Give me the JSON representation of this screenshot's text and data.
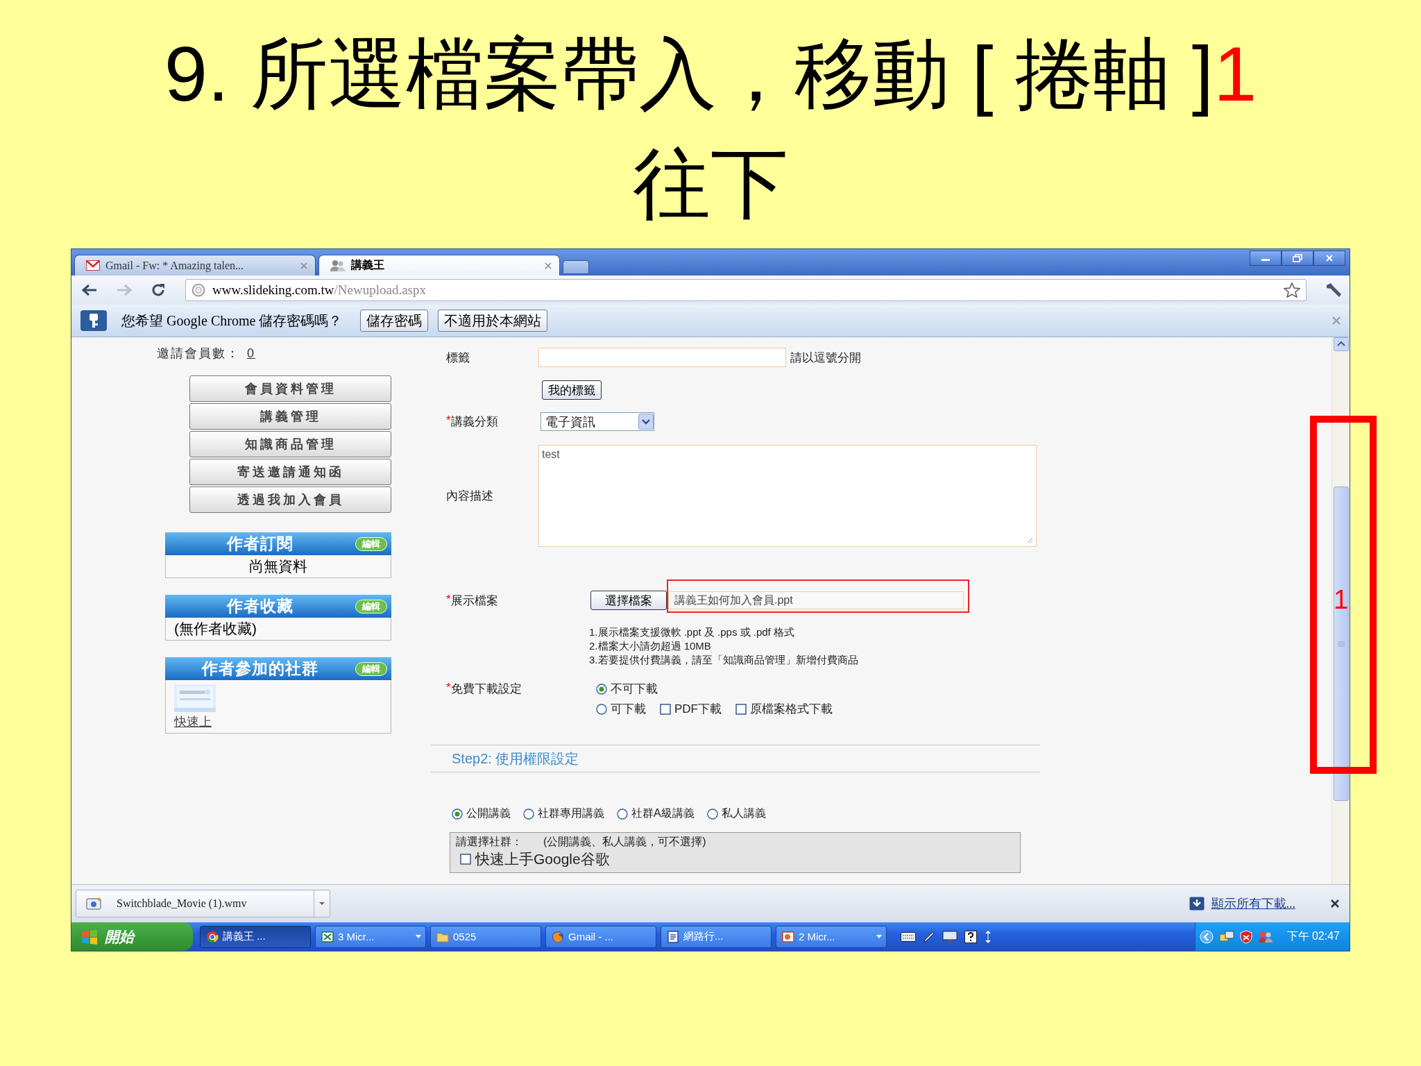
{
  "slide_title": {
    "line_1": "9. 所選檔案帶入，移動 [ 捲軸 ]",
    "marker": "1",
    "line_2": "往下"
  },
  "browser": {
    "tabs": [
      {
        "title": "Gmail - Fw: * Amazing talen...",
        "kind": "mail",
        "selected": false
      },
      {
        "title": "講義王",
        "kind": "site",
        "selected": true
      }
    ],
    "url": "www.slideking.com.tw/Newupload.aspx",
    "infobar": {
      "message": "您希望 Google Chrome 儲存密碼嗎？",
      "buttons": [
        "儲存密碼",
        "不適用於本網站"
      ]
    }
  },
  "sidebar": {
    "invite_label": "邀請會員數：",
    "invite_count": "0",
    "menu": [
      "會員資料管理",
      "講義管理",
      "知識商品管理",
      "寄送邀請通知函",
      "透過我加入會員"
    ],
    "panels": [
      {
        "title": "作者訂閱",
        "edit": "編輯",
        "kind": "notice",
        "body": "尚無資料"
      },
      {
        "title": "作者收藏",
        "edit": "編輯",
        "kind": "list",
        "body": "(無作者收藏)"
      },
      {
        "title": "作者參加的社群",
        "edit": "編輯",
        "kind": "community",
        "body": "快速上"
      }
    ]
  },
  "form": {
    "tags": {
      "label": "標籤",
      "hint": "請以逗號分開",
      "button": "我的標籤"
    },
    "category": {
      "mark": "*",
      "label": "講義分類",
      "value": "電子資訊"
    },
    "description": {
      "label": "內容描述",
      "value": "test"
    },
    "file": {
      "mark": "*",
      "label": "展示檔案",
      "button": "選擇檔案",
      "value": "講義王如何加入會員.ppt",
      "highlighted": true,
      "notes": [
        "1.展示檔案支援微軟 .ppt 及 .pps 或 .pdf 格式",
        "2.檔案大小請勿超過 10MB",
        "3.若要提供付費講義，請至「知識商品管理」新增付費商品"
      ]
    },
    "download": {
      "mark": "*",
      "label": "免費下載設定",
      "options": [
        {
          "label": "不可下載",
          "kind": "radio",
          "selected": true
        },
        {
          "label": "可下載",
          "kind": "radio",
          "selected": false
        },
        {
          "label": "PDF下載",
          "kind": "checkbox",
          "checked": false
        },
        {
          "label": "原檔案格式下載",
          "kind": "checkbox",
          "checked": false
        }
      ]
    },
    "step2": {
      "heading": "Step2: 使用權限設定",
      "visibility": [
        {
          "label": "公開講義",
          "selected": true
        },
        {
          "label": "社群專用講義",
          "selected": false
        },
        {
          "label": "社群A級講義",
          "selected": false
        },
        {
          "label": "私人講義",
          "selected": false
        }
      ],
      "prompt": "請選擇社群：",
      "note": "(公開講義、私人講義，可不選擇)",
      "communities": [
        {
          "label": "快速上手Google谷歌",
          "checked": false
        }
      ]
    }
  },
  "scroll_annotation": {
    "marker": "1"
  },
  "download_shelf": {
    "file": "Switchblade_Movie (1).wmv",
    "show_all": "顯示所有下載..."
  },
  "taskbar": {
    "start": "開始",
    "items": [
      {
        "label": "講義王 ...",
        "kind": "chrome",
        "grouped": false,
        "selected": true
      },
      {
        "label": "3 Micr...",
        "kind": "excel",
        "grouped": true,
        "selected": false
      },
      {
        "label": "0525",
        "kind": "folder",
        "grouped": false,
        "selected": false
      },
      {
        "label": "Gmail - ...",
        "kind": "firefox",
        "grouped": false,
        "selected": false
      },
      {
        "label": "網路行...",
        "kind": "word",
        "grouped": false,
        "selected": false
      },
      {
        "label": "2 Micr...",
        "kind": "powerpoint",
        "grouped": true,
        "selected": false
      }
    ],
    "clock": "下午 02:47"
  }
}
